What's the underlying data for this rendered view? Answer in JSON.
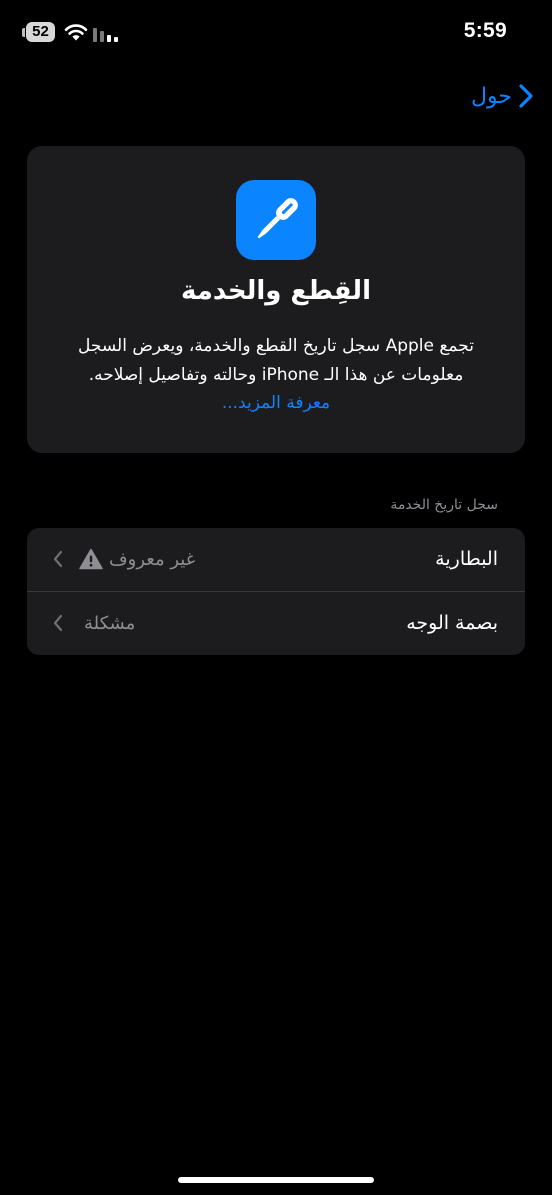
{
  "status_bar": {
    "battery_level": "52",
    "time": "5:59",
    "wifi_icon": "wifi-icon",
    "signal_icon": "cellular-signal-icon"
  },
  "nav": {
    "back_label": "حول",
    "back_icon": "chevron-right-icon"
  },
  "hero": {
    "icon": "screwdriver-icon",
    "title": "القِطع والخدمة",
    "description_lines": [
      "تجمع Apple سجل تاريخ القطع والخدمة، ويعرض السجل",
      "معلومات عن هذا الـ iPhone وحالته وتفاصيل إصلاحه."
    ],
    "learn_more": "معرفة المزيد..."
  },
  "section": {
    "header": "سجل تاريخ الخدمة",
    "rows": [
      {
        "title": "البطارية",
        "value": "غير معروف",
        "status_icon": "warning-icon"
      },
      {
        "title": "بصمة الوجه",
        "value": "مشكلة"
      }
    ]
  },
  "colors": {
    "background": "#000000",
    "card": "#1c1c1e",
    "accent": "#0a84ff",
    "secondary_text": "#8e8e93",
    "separator": "#38383a"
  }
}
